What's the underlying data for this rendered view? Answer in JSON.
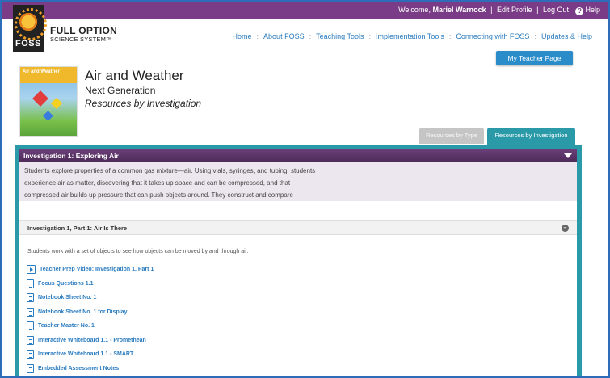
{
  "topbar": {
    "welcome_prefix": "Welcome,",
    "user_name": "Mariel Warnock",
    "edit_profile": "Edit Profile",
    "log_out": "Log Out",
    "help": "Help",
    "help_icon": "question-circle-icon",
    "separator": "|"
  },
  "logo": {
    "word": "FOSS",
    "icon": "sun-icon"
  },
  "brand": {
    "line1": "FULL OPTION",
    "line2": "SCIENCE SYSTEM™"
  },
  "nav": {
    "items": [
      {
        "label": "Home"
      },
      {
        "label": "About FOSS"
      },
      {
        "label": "Teaching Tools"
      },
      {
        "label": "Implementation Tools"
      },
      {
        "label": "Connecting with FOSS"
      },
      {
        "label": "Updates & Help"
      }
    ],
    "separator": ":"
  },
  "teacher_page_button": "My Teacher Page",
  "module": {
    "cover_title": "Air and Weather",
    "title": "Air and Weather",
    "subtitle": "Next Generation",
    "view": "Resources by Investigation"
  },
  "tabs": {
    "by_type": "Resources by Type",
    "by_investigation": "Resources by Investigation"
  },
  "investigation": {
    "title": "Investigation 1: Exploring Air",
    "description": "Students explore properties of a common gas mixture—air. Using vials, syringes, and tubing, students experience air as matter, discovering that it takes up space and can be compressed, and that compressed air builds up pressure that can push objects around. They construct and compare parachutes and balloon rockets that use air.",
    "caret_icon": "caret-down-icon"
  },
  "part": {
    "title": "Investigation 1, Part 1: Air Is There",
    "intro": "Students work with a set of objects to see how objects can be moved by and through air.",
    "collapse_icon": "minus-circle-icon",
    "resources": [
      {
        "label": "Teacher Prep Video: Investigation 1, Part 1",
        "icon": "video-icon"
      },
      {
        "label": "Focus Questions 1.1",
        "icon": "document-icon"
      },
      {
        "label": "Notebook Sheet No. 1",
        "icon": "pdf-icon"
      },
      {
        "label": "Notebook Sheet No. 1 for Display",
        "icon": "pdf-icon"
      },
      {
        "label": "Teacher Master No. 1",
        "icon": "pdf-icon"
      },
      {
        "label": "Interactive Whiteboard 1.1 - Promethean",
        "icon": "whiteboard-icon"
      },
      {
        "label": "Interactive Whiteboard 1.1 - SMART",
        "icon": "whiteboard-icon"
      },
      {
        "label": "Embedded Assessment Notes",
        "icon": "pdf-icon"
      }
    ]
  },
  "colors": {
    "top_purple": "#7a3c86",
    "investigation_header": "#5a3366",
    "teal": "#2a9aa8",
    "link_blue": "#2a7bbf",
    "button_blue": "#2a8cc9"
  }
}
